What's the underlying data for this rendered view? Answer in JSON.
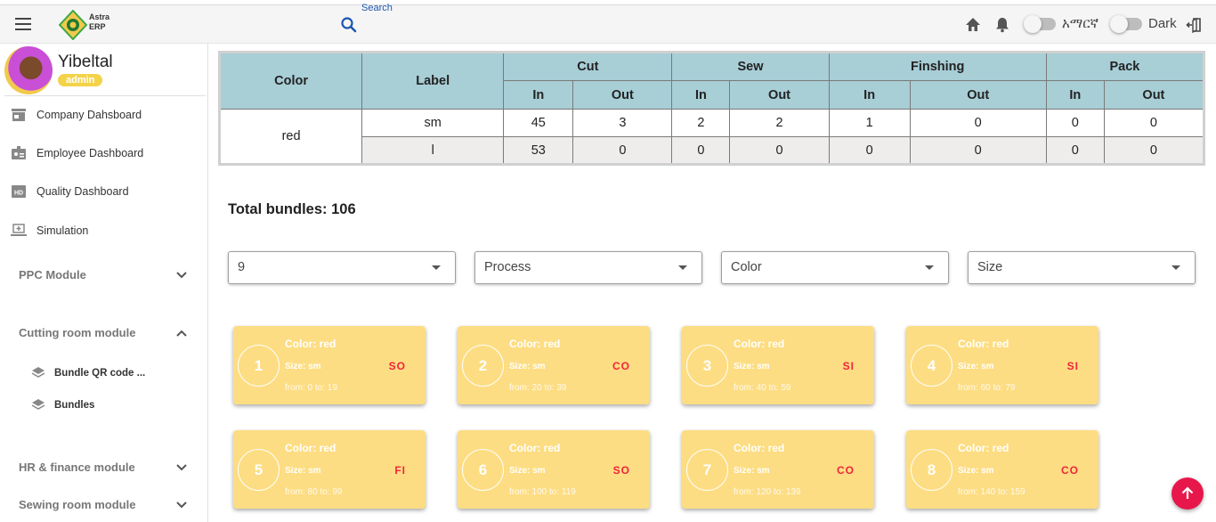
{
  "header": {
    "logo_text_line1": "Astra",
    "logo_text_line2": "ERP",
    "search_label": "Search",
    "language_label": "አማርኛ",
    "dark_label": "Dark"
  },
  "sidebar": {
    "user_name": "Yibeltal",
    "user_role": "admin",
    "nav_items": [
      {
        "label": "Company Dahsboard",
        "icon": "storefront-icon"
      },
      {
        "label": "Employee Dashboard",
        "icon": "badge-icon"
      },
      {
        "label": "Quality Dashboard",
        "icon": "hd-icon"
      },
      {
        "label": "Simulation",
        "icon": "simulation-icon"
      }
    ],
    "modules": [
      {
        "label": "PPC Module",
        "expanded": false
      },
      {
        "label": "Cutting room module",
        "expanded": true
      },
      {
        "label": "HR & finance module",
        "expanded": false
      },
      {
        "label": "Sewing room module",
        "expanded": false
      }
    ],
    "sub_items": [
      {
        "label": "Bundle QR code ...",
        "icon": "layers-icon"
      },
      {
        "label": "Bundles",
        "icon": "layers-icon"
      }
    ]
  },
  "table": {
    "headers": {
      "color": "Color",
      "label": "Label",
      "groups": [
        "Cut",
        "Sew",
        "Finshing",
        "Pack"
      ],
      "in": "In",
      "out": "Out"
    },
    "color": "red",
    "rows": [
      {
        "label": "sm",
        "values": [
          "45",
          "3",
          "2",
          "2",
          "1",
          "0",
          "0",
          "0"
        ]
      },
      {
        "label": "l",
        "values": [
          "53",
          "0",
          "0",
          "0",
          "0",
          "0",
          "0",
          "0"
        ]
      }
    ]
  },
  "total_bundles": "Total bundles: 106",
  "filters": [
    {
      "value": "9"
    },
    {
      "value": "Process"
    },
    {
      "value": "Color"
    },
    {
      "value": "Size"
    }
  ],
  "cards": [
    {
      "num": "1",
      "color": "Color: red",
      "size": "Size: sm",
      "range": "from: 0 to: 19",
      "status": "SO"
    },
    {
      "num": "2",
      "color": "Color: red",
      "size": "Size: sm",
      "range": "from: 20 to: 39",
      "status": "CO"
    },
    {
      "num": "3",
      "color": "Color: red",
      "size": "Size: sm",
      "range": "from: 40 to: 59",
      "status": "SI"
    },
    {
      "num": "4",
      "color": "Color: red",
      "size": "Size: sm",
      "range": "from: 60 to: 79",
      "status": "SI"
    },
    {
      "num": "5",
      "color": "Color: red",
      "size": "Size: sm",
      "range": "from: 80 to: 99",
      "status": "FI"
    },
    {
      "num": "6",
      "color": "Color: red",
      "size": "Size: sm",
      "range": "from: 100 to: 119",
      "status": "SO"
    },
    {
      "num": "7",
      "color": "Color: red",
      "size": "Size: sm",
      "range": "from: 120 to: 139",
      "status": "CO"
    },
    {
      "num": "8",
      "color": "Color: red",
      "size": "Size: sm",
      "range": "from: 140 to: 159",
      "status": "CO"
    }
  ],
  "colors": {
    "table_header": "#a8ced6",
    "card_bg": "#fddd83",
    "status_text": "#f0243a",
    "badge": "#f3d34a",
    "fab": "#e8174b"
  }
}
